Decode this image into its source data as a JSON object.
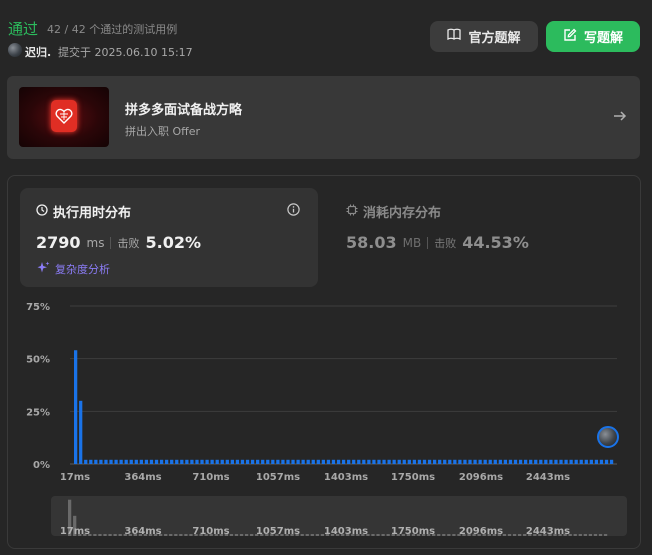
{
  "result": {
    "status": "通过",
    "passed_text": "42 / 42 个通过的测试用例"
  },
  "submission": {
    "user": "迟归.",
    "submitted_at": "提交于 2025.06.10 15:17"
  },
  "buttons": {
    "official": "官方题解",
    "write": "写题解"
  },
  "banner": {
    "title": "拼多多面试备战方略",
    "subtitle": "拼出入职 Offer"
  },
  "runtime": {
    "title": "执行用时分布",
    "value": "2790",
    "unit": "ms",
    "beats_label": "击败",
    "beats": "5.02%"
  },
  "memory": {
    "title": "消耗内存分布",
    "value": "58.03",
    "unit": "MB",
    "beats_label": "击败",
    "beats": "44.53%"
  },
  "complexity_label": "复杂度分析",
  "colors": {
    "accent_green": "#2cbb5d",
    "bar_blue": "#1a73e8",
    "purple": "#8b7cf6"
  },
  "chart_data": {
    "type": "bar",
    "y_ticks": [
      "75%",
      "50%",
      "25%",
      "0%"
    ],
    "ylim": [
      0,
      75
    ],
    "x_ticks": [
      "17ms",
      "364ms",
      "710ms",
      "1057ms",
      "1403ms",
      "1750ms",
      "2096ms",
      "2443ms"
    ],
    "values": [
      54,
      30,
      2,
      2,
      2,
      2,
      2,
      2,
      2,
      2,
      2,
      2,
      2,
      2,
      2,
      2,
      2,
      2,
      2,
      2,
      2,
      2,
      2,
      2,
      2,
      2,
      2,
      2,
      2,
      2,
      2,
      2,
      2,
      2,
      2,
      2,
      2,
      2,
      2,
      2,
      2,
      2,
      2,
      2,
      2,
      2,
      2,
      2,
      2,
      2,
      2,
      2,
      2,
      2,
      2,
      2,
      2,
      2,
      2,
      2,
      2,
      2,
      2,
      2,
      2,
      2,
      2,
      2,
      2,
      2,
      2,
      2,
      2,
      2,
      2,
      2,
      2,
      2,
      2,
      2,
      2,
      2,
      2,
      2,
      2,
      2,
      2,
      2,
      2,
      2,
      2,
      2,
      2,
      2,
      2,
      2,
      2,
      2,
      2,
      2,
      2,
      2,
      2,
      2,
      2,
      2,
      2
    ]
  }
}
